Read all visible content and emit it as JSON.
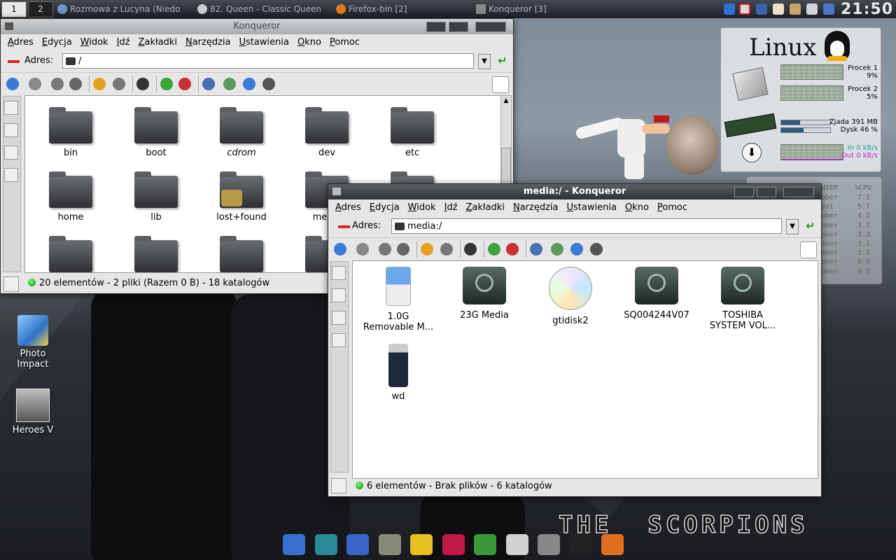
{
  "top_panel": {
    "desktops": [
      "1",
      "2"
    ],
    "tasks": [
      {
        "label": "Rozmowa z Lucyna (Niedo",
        "color": "#6e93c4"
      },
      {
        "label": "82. Queen - Classic Queen",
        "color": "#cccccc"
      },
      {
        "label": "Firefox-bin [2]",
        "color": "#e4781e"
      },
      {
        "label": "Konqueror [3]",
        "color": "#888888"
      }
    ],
    "clock": "21:50"
  },
  "desktop_icons": [
    {
      "label": "Photo Impact",
      "icon": "photo-impact-icon"
    },
    {
      "label": "Heroes V",
      "icon": "heroes-v-icon"
    }
  ],
  "window1": {
    "title": "Konqueror",
    "menu": [
      "Adres",
      "Edycja",
      "Widok",
      "Idź",
      "Zakładki",
      "Narzędzia",
      "Ustawienia",
      "Okno",
      "Pomoc"
    ],
    "address_label": "Adres:",
    "address_value": "/",
    "items": [
      "bin",
      "boot",
      "cdrom",
      "dev",
      "etc",
      "home",
      "lib",
      "lost+found",
      "media",
      "",
      "",
      "",
      "",
      ""
    ],
    "status": "20 elementów - 2 pliki (Razem 0 B) - 18 katalogów"
  },
  "window2": {
    "title": "media:/ - Konqueror",
    "menu": [
      "Adres",
      "Edycja",
      "Widok",
      "Idź",
      "Zakładki",
      "Narzędzia",
      "Ustawienia",
      "Okno",
      "Pomoc"
    ],
    "address_label": "Adres:",
    "address_value": "media:/",
    "items": [
      {
        "label": "1.0G\nRemovable M...",
        "icon": "removable-media-icon"
      },
      {
        "label": "23G Media",
        "icon": "hard-disk-icon"
      },
      {
        "label": "gtidisk2",
        "icon": "cdrom-icon"
      },
      {
        "label": "SQ004244V07",
        "icon": "hard-disk-icon"
      },
      {
        "label": "TOSHIBA\nSYSTEM VOL...",
        "icon": "hard-disk-icon"
      },
      {
        "label": "wd",
        "icon": "usb-drive-icon"
      }
    ],
    "status": "6 elementów - Brak plików - 6 katalogów"
  },
  "sysmon": {
    "logo": "Linux",
    "cpu1_label": "Procek 1",
    "cpu1_value": "9%",
    "cpu1_level": 0.09,
    "cpu2_label": "Procek 2",
    "cpu2_value": "5%",
    "cpu2_level": 0.05,
    "mem_label": "Zjada 391 MB",
    "mem_level": 0.38,
    "disk_label": "Dysk 46 %",
    "disk_level": 0.46,
    "net_in": "In 0 kB/s",
    "net_out": "Out 0 kB/s"
  },
  "procmon": {
    "header_user": "USER",
    "header_cpu": "%CPU",
    "rows": [
      {
        "user": "ober",
        "cpu": "7.5"
      },
      {
        "user": "bot",
        "cpu": "5.7"
      },
      {
        "user": "ober",
        "cpu": "4.2"
      },
      {
        "user": "ober",
        "cpu": "3.7"
      },
      {
        "user": "ober",
        "cpu": "3.3"
      },
      {
        "user": "ober",
        "cpu": "3.1"
      },
      {
        "user": "ober",
        "cpu": "2.1"
      },
      {
        "user": "ober",
        "cpu": "0.9"
      },
      {
        "user": "ober",
        "cpu": "0.3"
      }
    ]
  },
  "wallpaper_text": "THE  SCORPIONS",
  "dock": [
    "kde-menu-icon",
    "network-icon",
    "mail-icon",
    "home-icon",
    "weather-icon",
    "ruby-icon",
    "windows-icon",
    "speaker-icon",
    "camera-icon",
    "terminal-icon",
    "firefox-icon"
  ],
  "colors": {
    "accent": "#2f5a78",
    "titlebar": "#3a3d41",
    "green": "#2a9a2a"
  }
}
